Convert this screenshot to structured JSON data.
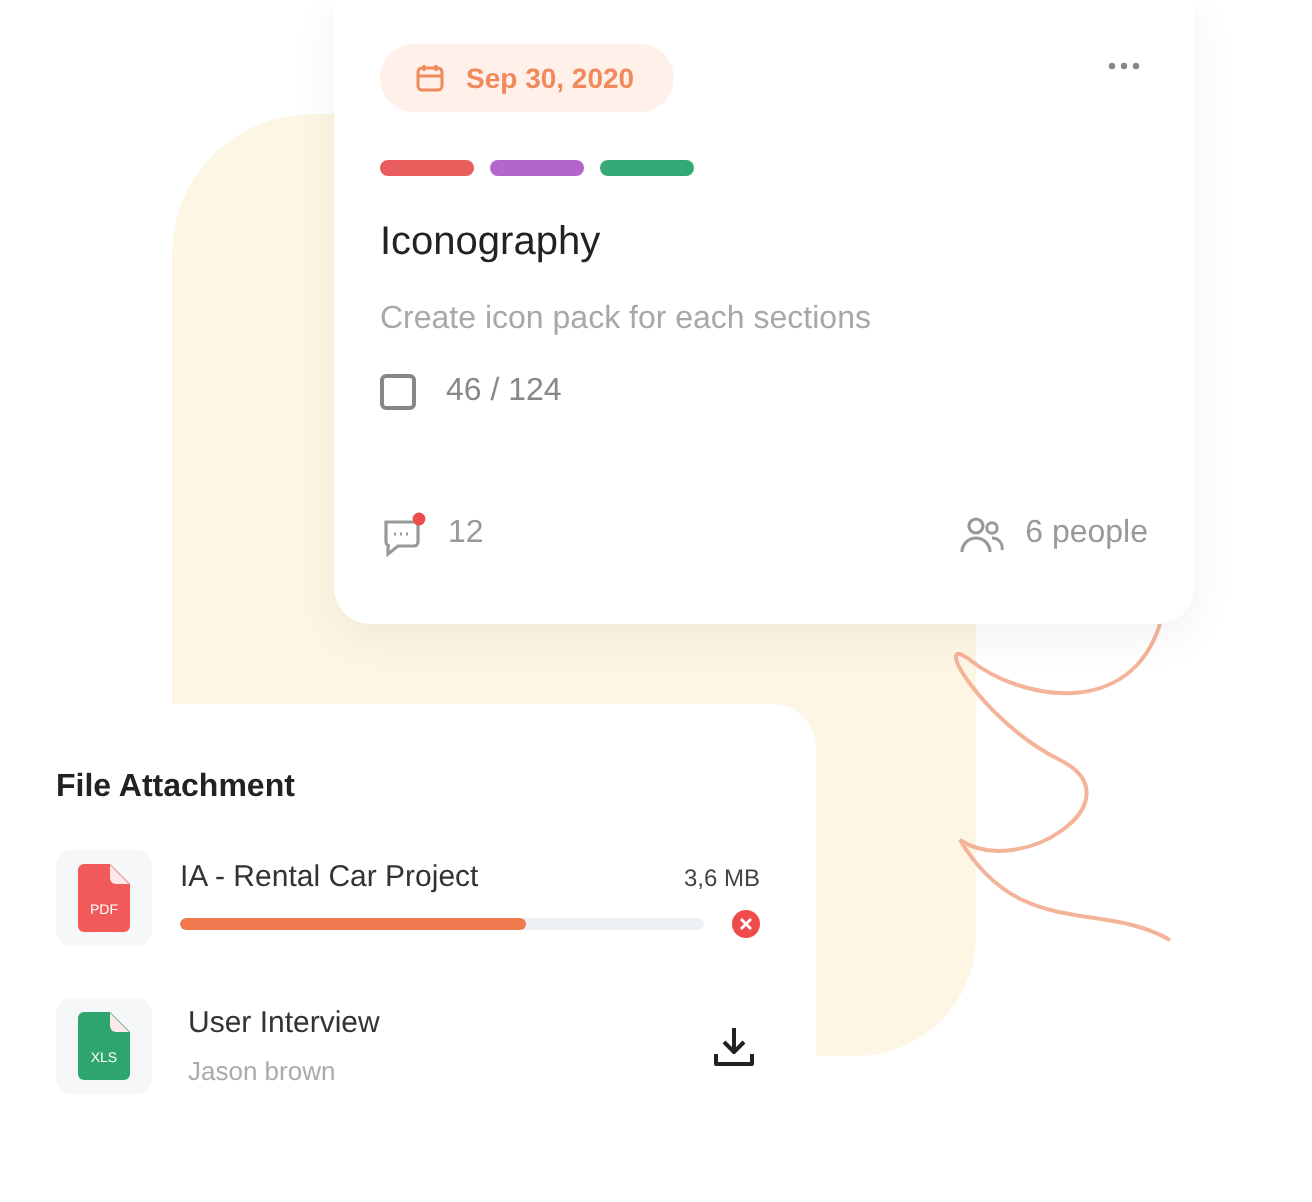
{
  "task_card": {
    "date": "Sep 30, 2020",
    "tags": [
      {
        "color": "#e85c5c"
      },
      {
        "color": "#b266cc"
      },
      {
        "color": "#34a877"
      }
    ],
    "title": "Iconography",
    "description": "Create icon pack for each sections",
    "checklist": {
      "checked": false,
      "progress": "46 / 124"
    },
    "comments": {
      "count": "12",
      "unread": true
    },
    "members": "6 people"
  },
  "file_attachment": {
    "title": "File Attachment",
    "files": [
      {
        "kind": "uploading",
        "name": "IA - Rental Car Project",
        "type_label": "PDF",
        "color": "#f25a5a",
        "size": "3,6 MB",
        "level": 0.66
      },
      {
        "kind": "download",
        "name": "User Interview",
        "owner": "Jason brown",
        "type_label": "XLS",
        "color": "#2fa56e"
      }
    ]
  }
}
